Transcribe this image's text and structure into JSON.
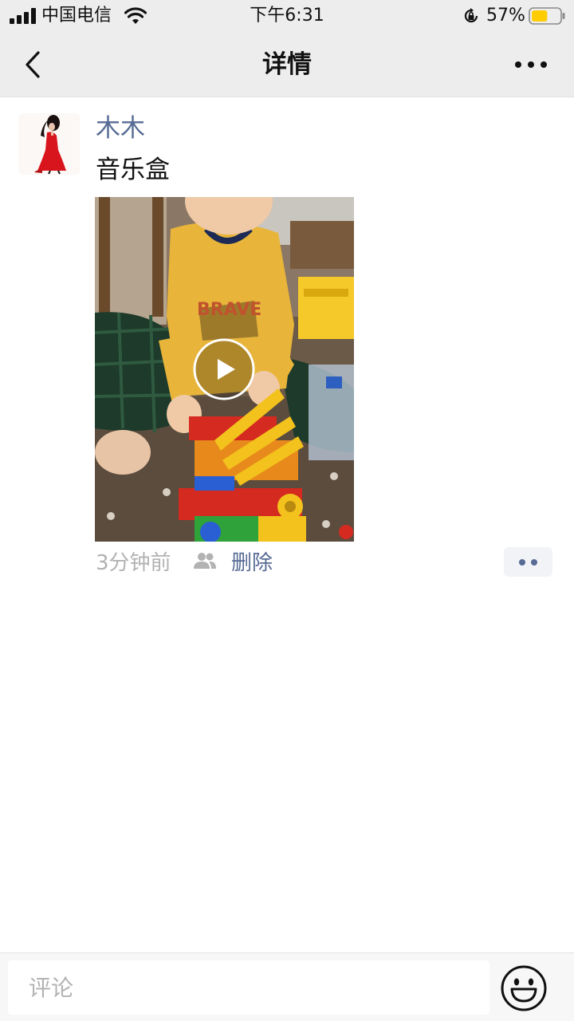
{
  "status_bar": {
    "carrier": "中国电信",
    "time": "下午6:31",
    "battery_percent": "57%",
    "battery_level": 0.57,
    "battery_color": "#ffcc00"
  },
  "nav": {
    "title": "详情",
    "back_icon": "chevron-left-icon",
    "more_icon": "ellipsis-icon"
  },
  "post": {
    "author": "木木",
    "text": "音乐盒",
    "media_type": "video",
    "timestamp": "3分钟前",
    "visibility_icon": "friends-icon",
    "delete_label": "删除",
    "action_icon": "two-dots-icon"
  },
  "comment_bar": {
    "placeholder": "评论",
    "emoji_icon": "smiley-icon"
  },
  "colors": {
    "link": "#576b95",
    "meta_gray": "#b2b2b2",
    "bar_background": "#ededed"
  }
}
